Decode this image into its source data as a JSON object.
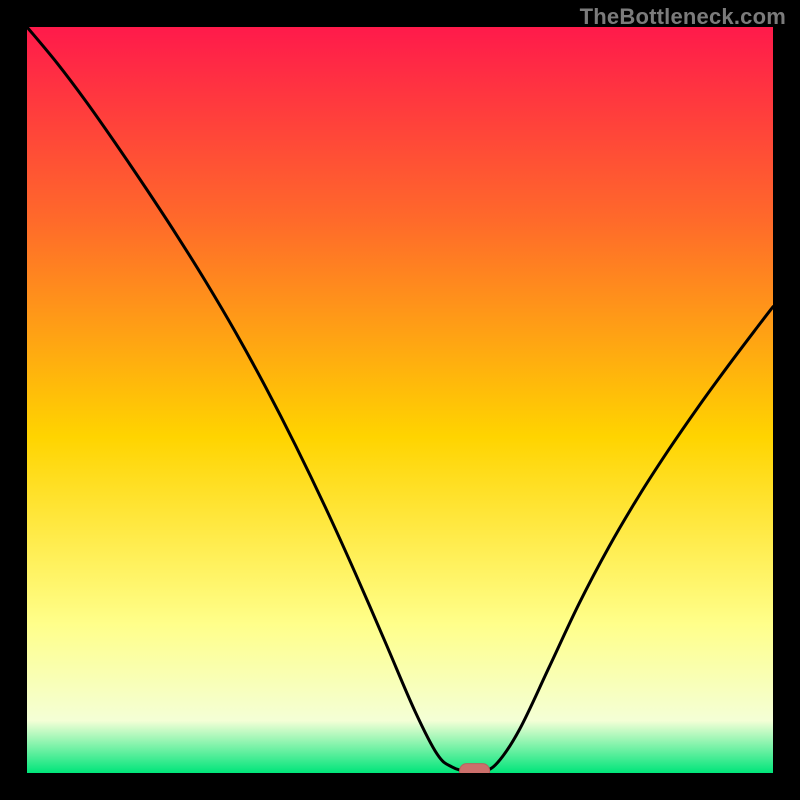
{
  "watermark": "TheBottleneck.com",
  "colors": {
    "frame": "#000000",
    "watermark_text": "#7b7b7b",
    "gradient_top": "#ff1a4b",
    "gradient_upper": "#ff6a2a",
    "gradient_mid": "#ffd400",
    "gradient_lower": "#ffff8a",
    "gradient_pale": "#f4ffd6",
    "gradient_bottom": "#00e57a",
    "curve": "#000000",
    "marker_fill": "#cc6f6b",
    "marker_stroke": "#b9615e"
  },
  "chart_data": {
    "type": "line",
    "title": "",
    "xlabel": "",
    "ylabel": "",
    "xlim": [
      0,
      100
    ],
    "ylim": [
      0,
      100
    ],
    "grid": false,
    "legend": false,
    "series": [
      {
        "name": "bottleneck-curve",
        "x": [
          0,
          4,
          8,
          12,
          16,
          20,
          24,
          28,
          32,
          36,
          40,
          44,
          48,
          52,
          55,
          57,
          59,
          61,
          63,
          66,
          70,
          74,
          78,
          82,
          86,
          90,
          94,
          98,
          100
        ],
        "y": [
          100,
          95.2,
          89.9,
          84.2,
          78.3,
          72.2,
          65.8,
          59,
          51.7,
          43.9,
          35.6,
          26.8,
          17.6,
          8.3,
          2.5,
          0.8,
          0.25,
          0.25,
          1.3,
          5.8,
          14.2,
          22.7,
          30.3,
          37.1,
          43.3,
          49.1,
          54.6,
          59.9,
          62.5
        ]
      }
    ],
    "marker": {
      "name": "optimal-point",
      "x": 60,
      "y": 0.25,
      "shape": "rounded-rect"
    }
  }
}
